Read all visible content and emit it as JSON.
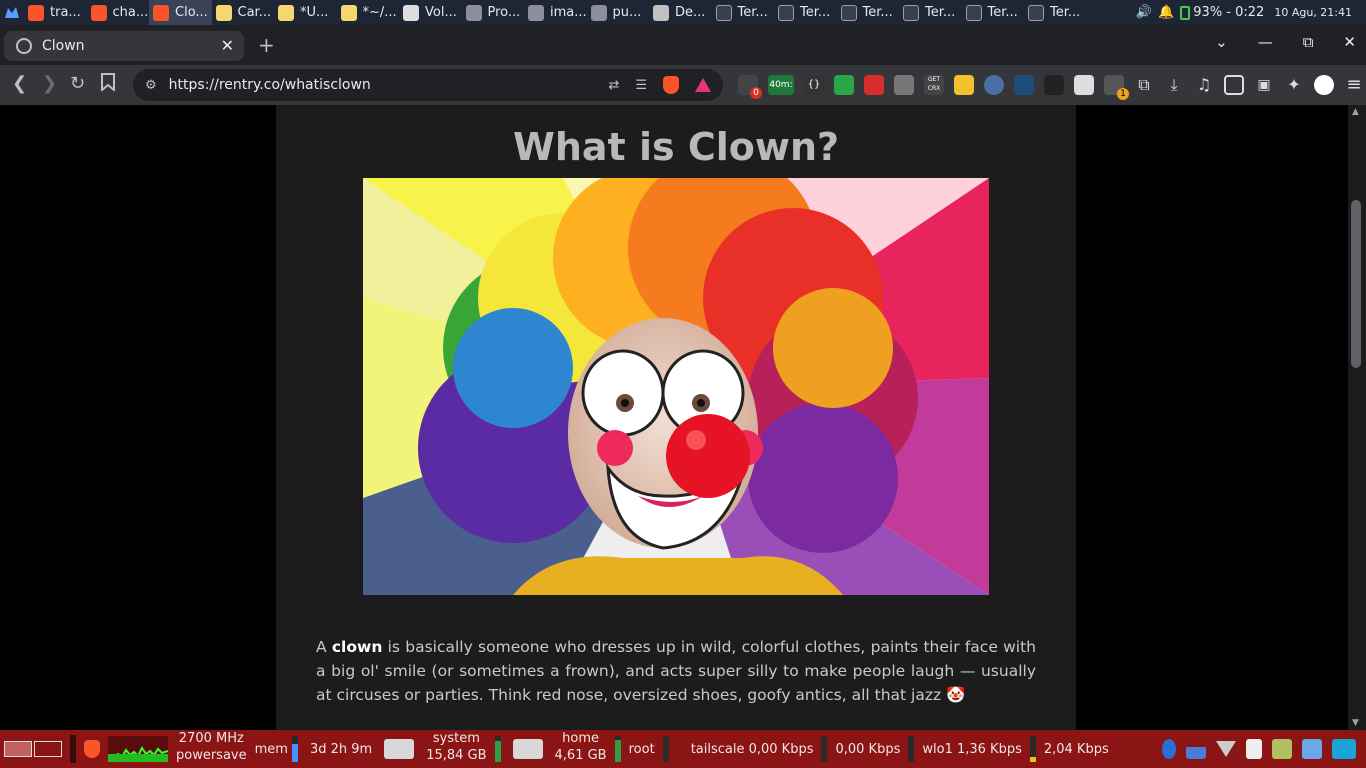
{
  "system_bar": {
    "tasks": [
      {
        "label": "tra...",
        "icon": "brave-icon"
      },
      {
        "label": "cha...",
        "icon": "brave-icon"
      },
      {
        "label": "Clo...",
        "icon": "brave-icon"
      },
      {
        "label": "Car...",
        "icon": "notepad-icon"
      },
      {
        "label": "*U...",
        "icon": "notepad-icon"
      },
      {
        "label": "*~/...",
        "icon": "notepad-icon"
      },
      {
        "label": "Vol...",
        "icon": "volume-app-icon"
      },
      {
        "label": "Pro...",
        "icon": "folder-icon"
      },
      {
        "label": "ima...",
        "icon": "folder-icon"
      },
      {
        "label": "pu...",
        "icon": "folder-icon"
      },
      {
        "label": "De...",
        "icon": "app-icon"
      },
      {
        "label": "Ter...",
        "icon": "terminal-icon"
      },
      {
        "label": "Ter...",
        "icon": "terminal-icon"
      },
      {
        "label": "Ter...",
        "icon": "terminal-icon"
      },
      {
        "label": "Ter...",
        "icon": "terminal-icon"
      },
      {
        "label": "Ter...",
        "icon": "terminal-icon"
      },
      {
        "label": "Ter...",
        "icon": "terminal-icon"
      }
    ],
    "battery": "93% - 0:22",
    "clock": "10 Agu, 21:41"
  },
  "browser": {
    "tab_title": "Clown",
    "url": "https://rentry.co/whatisclown",
    "extension_badges": {
      "shield_count": "0",
      "timer": "40m:",
      "notifications": "1"
    },
    "extension_labels": {
      "curly": "{}",
      "getcrx": "GET CRX"
    }
  },
  "article": {
    "title": "What is Clown?",
    "image_alt": "clown with rainbow wig",
    "intro_prefix": "A ",
    "intro_bold": "clown",
    "intro_rest": " is basically someone who dresses up in wild, colorful clothes, paints their face with a big ol' smile (or sometimes a frown), and acts super silly to make people laugh — usually at circuses or parties. Think red nose, oversized shoes, goofy antics, all that jazz 🤡"
  },
  "bottom_panel": {
    "cpu_freq": "2700 MHz",
    "cpu_gov": "powersave",
    "mem_label": "mem",
    "uptime": "3d 2h 9m",
    "disk_system_label": "system",
    "disk_system_size": "15,84 GB",
    "disk_home_label": "home",
    "disk_home_size": "4,61 GB",
    "disk_root_label": "root",
    "net_tailscale": "tailscale 0,00 Kbps",
    "net_tailscale_up": "0,00 Kbps",
    "net_wlo1": "wlo1 1,36 Kbps",
    "net_wlo1_up": "2,04 Kbps"
  },
  "colors": {
    "panel_bg": "#8b1414",
    "article_bg": "#1c1c1c",
    "title_color": "#b8b8b8"
  }
}
